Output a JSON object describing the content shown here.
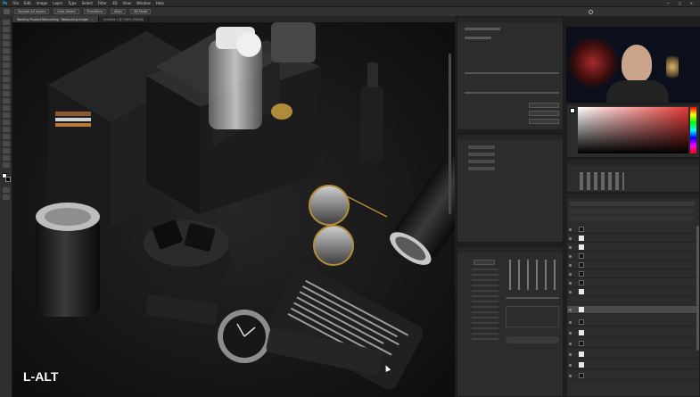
{
  "menubar": {
    "items": [
      "Ps",
      "File",
      "Edit",
      "Image",
      "Layer",
      "Type",
      "Select",
      "Filter",
      "3D",
      "View",
      "Window",
      "Help"
    ]
  },
  "options": {
    "items": [
      "Sample All Layers",
      "Auto-Select",
      "Transform",
      "Align",
      "3D Mode"
    ]
  },
  "tabs": {
    "items": [
      {
        "label": "Working Product Retouching · Retouching Image · ..."
      },
      {
        "label": "Untitled-1 @ 100% (RGB/8)"
      }
    ]
  },
  "overlay": {
    "key_label": "L-ALT"
  },
  "colors": {
    "accent": "#2f8bd6",
    "canvas_bg": "#141414",
    "panel_bg": "#2c2c2c"
  }
}
